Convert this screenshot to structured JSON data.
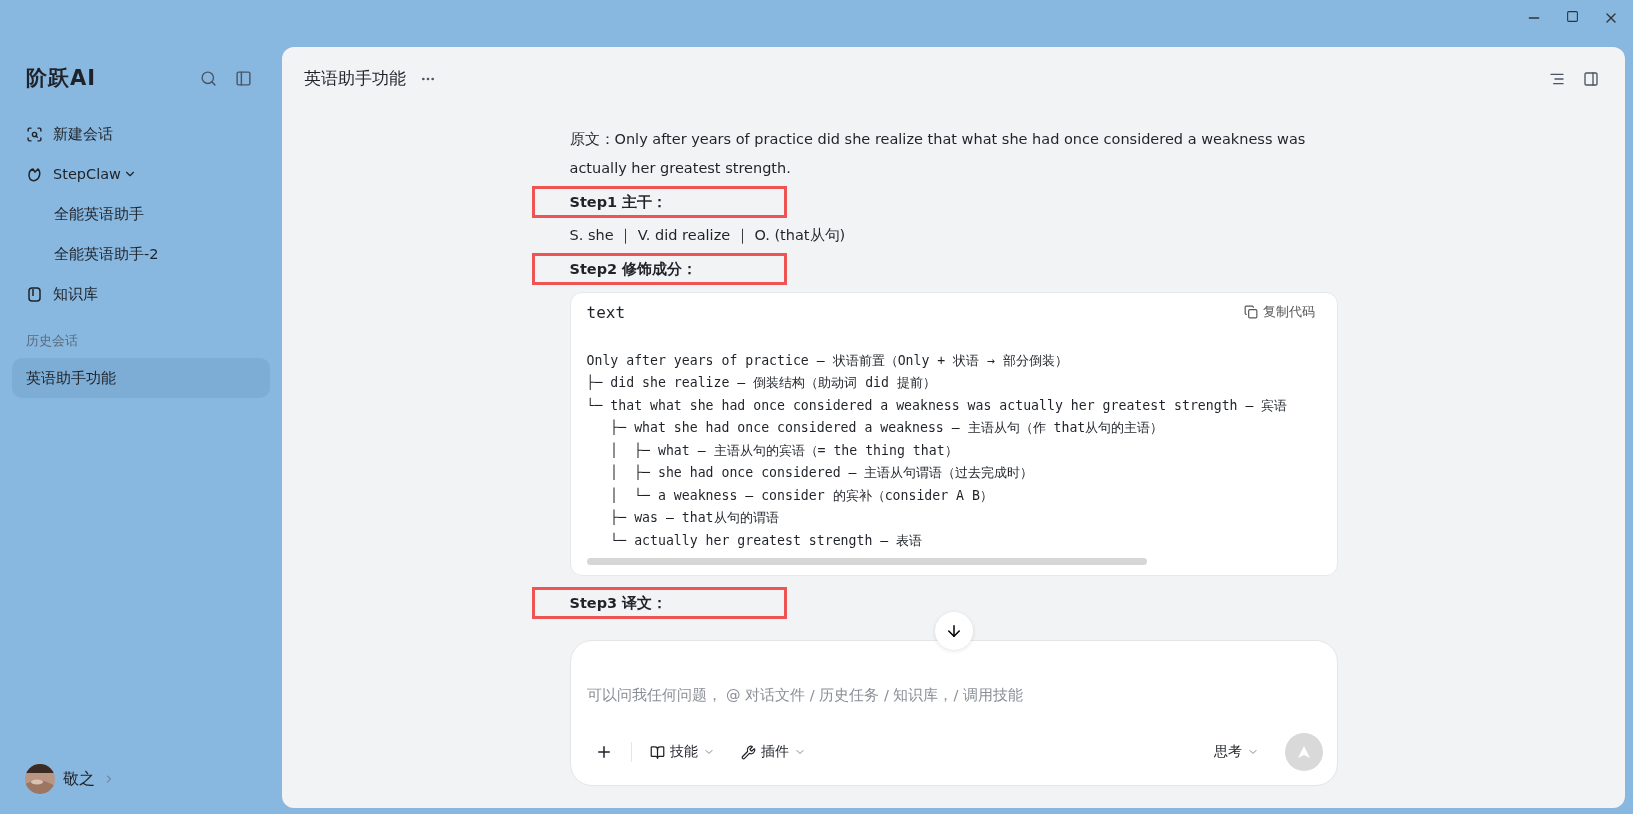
{
  "sidebar": {
    "brand": "阶跃AI",
    "nav": [
      {
        "kind": "new",
        "label": "新建会话"
      },
      {
        "kind": "group",
        "label": "StepClaw",
        "expanded": true,
        "children": [
          {
            "label": "全能英语助手"
          },
          {
            "label": "全能英语助手-2"
          }
        ]
      },
      {
        "kind": "library",
        "label": "知识库"
      }
    ],
    "history_heading": "历史会话",
    "history": [
      {
        "label": "英语助手功能",
        "selected": true
      }
    ],
    "user": {
      "name": "敬之"
    }
  },
  "chat": {
    "title": "英语助手功能",
    "messages": [
      {
        "kind": "paragraph",
        "text": "原文：Only after years of practice did she realize that what she had once considered a weakness was actually her greatest strength."
      },
      {
        "kind": "step",
        "text": "Step1 主干：",
        "highlighted": true
      },
      {
        "kind": "paragraph",
        "text": "S. she ｜ V. did realize ｜ O. (that从句)"
      },
      {
        "kind": "step",
        "text": "Step2 修饰成分：",
        "highlighted": true
      },
      {
        "kind": "code",
        "language": "text",
        "copy_label": "复制代码",
        "lines": [
          "Only after years of practice — 状语前置（Only + 状语 → 部分倒装）",
          "├─ did she realize — 倒装结构（助动词 did 提前）",
          "└─ that what she had once considered a weakness was actually her greatest strength — 宾语",
          "   ├─ what she had once considered a weakness — 主语从句（作 that从句的主语）",
          "   │  ├─ what — 主语从句的宾语（= the thing that）",
          "   │  ├─ she had once considered — 主语从句谓语（过去完成时）",
          "   │  └─ a weakness — consider 的宾补（consider A B）",
          "   ├─ was — that从句的谓语",
          "   └─ actually her greatest strength — 表语"
        ]
      },
      {
        "kind": "step",
        "text": "Step3 译文：",
        "highlighted": true
      }
    ],
    "composer": {
      "placeholder": "可以问我任何问题， @ 对话文件 / 历史任务 / 知识库，/ 调用技能",
      "tools": [
        {
          "kind": "skills",
          "label": "技能"
        },
        {
          "kind": "plugins",
          "label": "插件"
        }
      ],
      "mode": "思考",
      "send_disabled": true
    }
  }
}
